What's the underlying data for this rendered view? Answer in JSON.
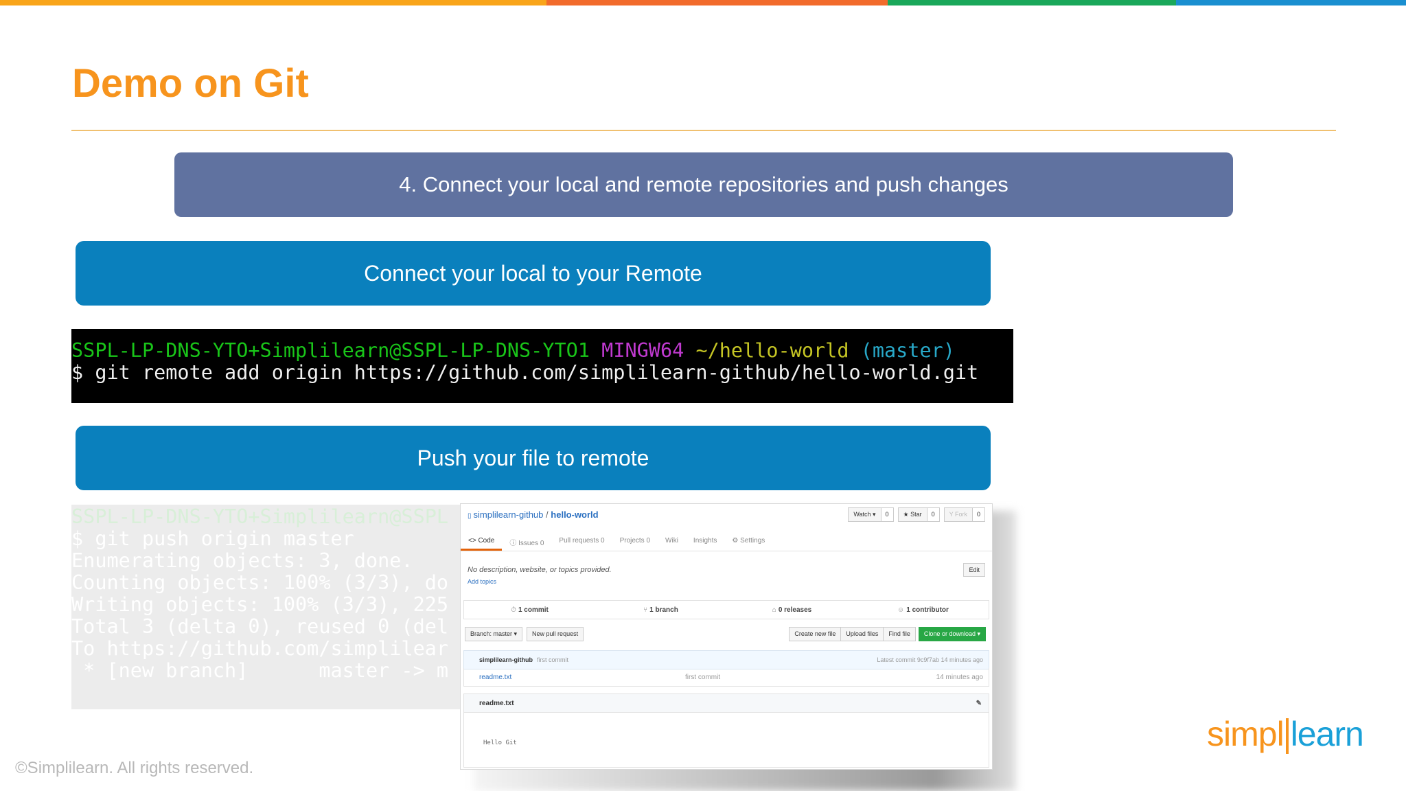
{
  "colors": {
    "top_bar": [
      "#f9a51a",
      "#f26b2b",
      "#1aa85a",
      "#1a8fd0"
    ],
    "title": "#f7941d",
    "step_banner": "#6072a0",
    "blue_banner": "#0a80bd"
  },
  "slide": {
    "title": "Demo on Git",
    "step_banner": "4. Connect your local and remote repositories and push changes",
    "connect_banner": "Connect your local to your Remote",
    "push_banner": "Push your file to remote"
  },
  "terminal": {
    "prompt_user": "SSPL-LP-DNS-YTO+Simplilearn@SSPL-LP-DNS-YTO1",
    "prompt_env": "MINGW64",
    "prompt_path": "~/hello-world",
    "prompt_branch": "(master)",
    "command": "$ git remote add origin https://github.com/simplilearn-github/hello-world.git"
  },
  "push_terminal": {
    "prompt_user": "SSPL-LP-DNS-YTO+Simplilearn@SSPL",
    "lines": [
      "$ git push origin master",
      "Enumerating objects: 3, done.",
      "Counting objects: 100% (3/3), do",
      "Writing objects: 100% (3/3), 225",
      "Total 3 (delta 0), reused 0 (del",
      "To https://github.com/simplilear",
      " * [new branch]      master -> m"
    ]
  },
  "github": {
    "owner": "simplilearn-github",
    "repo": "hello-world",
    "actions": {
      "watch": "Watch ▾",
      "watch_count": "0",
      "star": "★ Star",
      "star_count": "0",
      "fork": "Y Fork",
      "fork_count": "0"
    },
    "tabs": {
      "code": "<> Code",
      "issues": "ⓘ Issues 0",
      "pulls": "Pull requests 0",
      "projects": "Projects 0",
      "wiki": "Wiki",
      "insights": "Insights",
      "settings": "⚙ Settings"
    },
    "description": "No description, website, or topics provided.",
    "add_topics": "Add topics",
    "edit": "Edit",
    "stats": {
      "commits": "1 commit",
      "branches": "1 branch",
      "releases": "0 releases",
      "contributors": "1 contributor"
    },
    "buttons": {
      "branch": "Branch: master ▾",
      "new_pr": "New pull request",
      "create_file": "Create new file",
      "upload": "Upload files",
      "find": "Find file",
      "clone": "Clone or download ▾"
    },
    "latest_commit": {
      "author": "simplilearn-github",
      "message": "first commit",
      "info": "Latest commit 9c9f7ab 14 minutes ago"
    },
    "files": [
      {
        "name": "readme.txt",
        "message": "first commit",
        "age": "14 minutes ago"
      }
    ],
    "readme_title": "readme.txt",
    "readme_content": "Hello Git"
  },
  "footer": {
    "copyright": "©Simplilearn. All rights reserved.",
    "logo_left": "simpl",
    "logo_right": "learn"
  }
}
